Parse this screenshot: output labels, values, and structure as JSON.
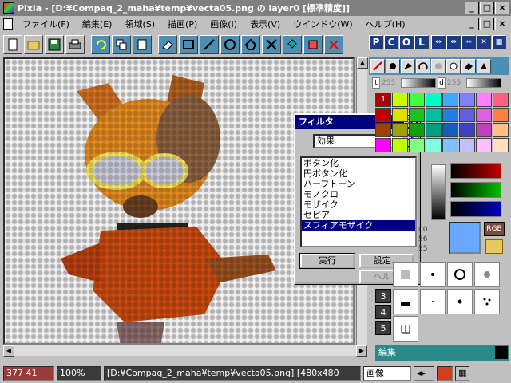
{
  "window": {
    "title": "Pixia - [D:¥Compaq_2_maha¥temp¥vecta05.png の layer0 [標準精度]]"
  },
  "menu": [
    "ファイル(F)",
    "編集(E)",
    "領域(S)",
    "描画(P)",
    "画像(I)",
    "表示(V)",
    "ウインドウ(W)",
    "ヘルプ(H)"
  ],
  "right_toolbar": {
    "p": "P",
    "c": "C",
    "o": "O",
    "l": "L"
  },
  "panel": {
    "t_label": "t",
    "t_value": "255",
    "d_label": "d",
    "d_value": "255",
    "rgb": "RGB"
  },
  "palette_numbers": [
    "1"
  ],
  "coord_values": [
    "00",
    "56",
    "55"
  ],
  "layer_numbers": [
    "3",
    "4",
    "5"
  ],
  "edit_label": "編集",
  "dialog": {
    "title": "フィルタ",
    "category": "効果",
    "items": [
      "ボタン化",
      "円ボタン化",
      "ハーフトーン",
      "モノクロ",
      "モザイク",
      "セピア",
      "スフィアモザイク"
    ],
    "selected_index": 6,
    "run": "実行",
    "settings": "設定...",
    "help": "ヘルプ"
  },
  "status": {
    "coords": "377 41",
    "zoom": "100%",
    "path": "[D:¥Compaq_2_maha¥temp¥vecta05.png] [480x480",
    "mode": "画像"
  },
  "colors": {
    "title_bg": "#808080",
    "dialog_title_bg": "#000080",
    "selection": "#000080",
    "accent_blue": "#4c8fb4",
    "swatch_blue": "#6aa8ff"
  }
}
